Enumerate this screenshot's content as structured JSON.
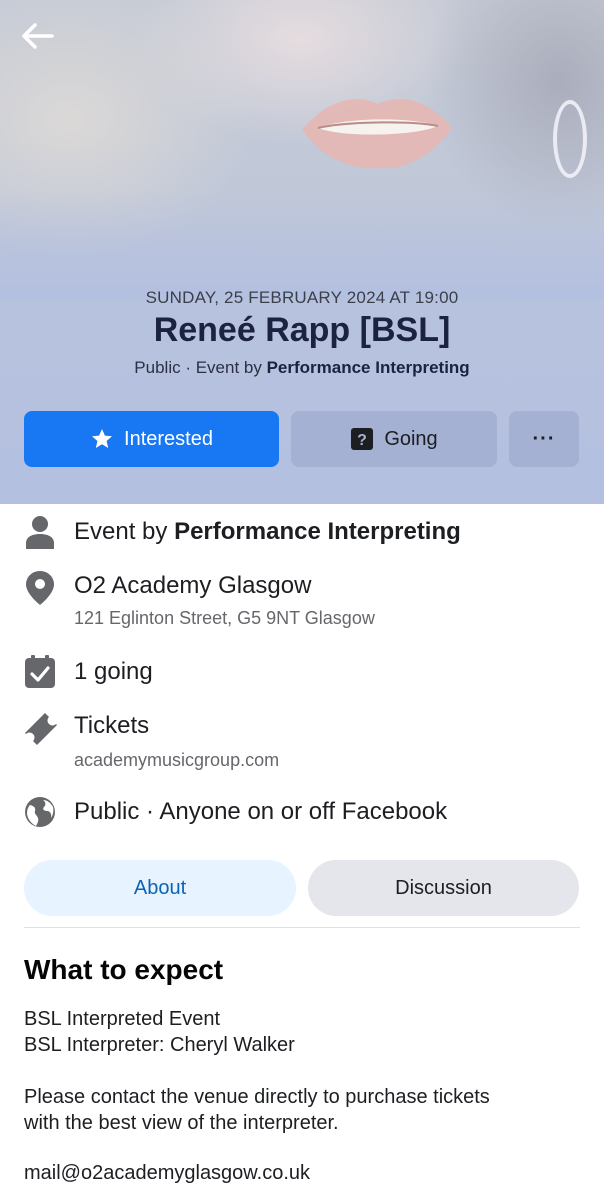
{
  "header": {
    "date": "SUNDAY, 25 FEBRUARY 2024 AT 19:00",
    "title": "Reneé Rapp [BSL]",
    "visibility_prefix": "Public · Event by ",
    "organizer": "Performance Interpreting",
    "back_icon": "back-arrow-icon"
  },
  "actions": {
    "interested_label": "Interested",
    "going_label": "Going",
    "more_label": "···",
    "accent_color": "#1877f2"
  },
  "details": {
    "organizer_prefix": "Event by ",
    "organizer_name": "Performance Interpreting",
    "venue_name": "O2 Academy Glasgow",
    "venue_address": "121 Eglinton Street, G5 9NT Glasgow",
    "going_count": "1 going",
    "tickets_label": "Tickets",
    "tickets_site": "academymusicgroup.com",
    "privacy": "Public · Anyone on or off Facebook"
  },
  "tabs": {
    "about": "About",
    "discussion": "Discussion"
  },
  "about": {
    "section_title": "What to expect",
    "line1": "BSL Interpreted Event",
    "line2": "BSL Interpreter: Cheryl Walker",
    "line3": "Please contact the venue directly to purchase tickets",
    "line4": "with the best view of the interpreter.",
    "email": "mail@o2academyglasgow.co.uk"
  }
}
